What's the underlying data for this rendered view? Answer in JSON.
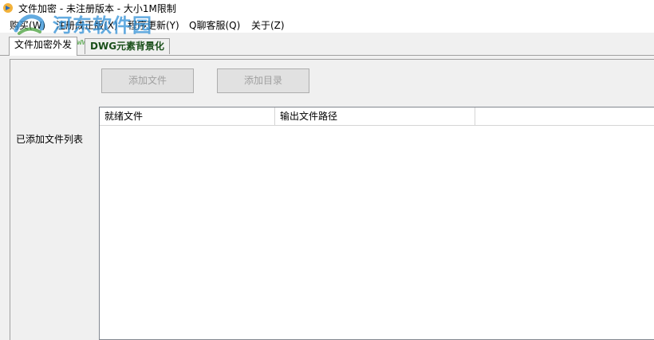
{
  "window": {
    "title": "文件加密 - 未注册版本 - 大小1M限制"
  },
  "menu": [
    {
      "label": "购买(W)"
    },
    {
      "label": "注册成正版(X)"
    },
    {
      "label": "程序更新(Y)"
    },
    {
      "label": "Q聊客服(Q)"
    },
    {
      "label": "关于(Z)"
    }
  ],
  "watermark": {
    "text": "河东软件园",
    "url": "www.pc0359.cn"
  },
  "tabs": [
    {
      "label": "文件加密外发",
      "active": true
    },
    {
      "label": "DWG元素背景化",
      "active": false
    }
  ],
  "buttons": {
    "add_file": "添加文件",
    "add_dir": "添加目录"
  },
  "side_label": "已添加文件列表",
  "table": {
    "columns": [
      "就绪文件",
      "输出文件路径",
      ""
    ],
    "rows": []
  },
  "colors": {
    "accent": "#2f8fd6",
    "disabled_text": "#a0a0a0"
  }
}
